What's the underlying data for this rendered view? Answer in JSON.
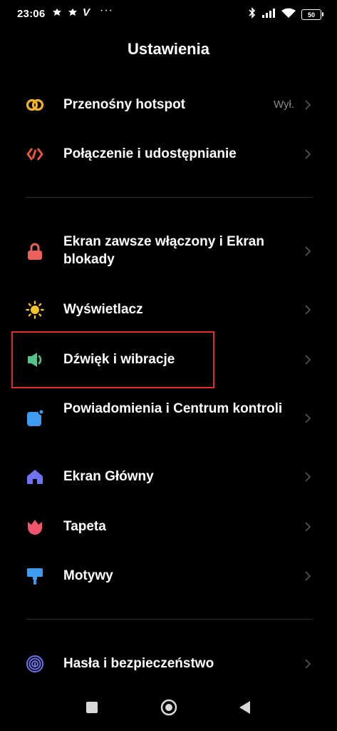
{
  "status_bar": {
    "time": "23:06",
    "indicators": [
      "notification-icon",
      "notification-icon",
      "v-app-icon",
      "more-dots"
    ],
    "battery": "50"
  },
  "header": {
    "title": "Ustawienia"
  },
  "settings": [
    {
      "label": "Przenośny hotspot",
      "value": "Wył.",
      "icon": "hotspot-icon",
      "color": "#F0B22A"
    },
    {
      "label": "Połączenie i udostępnianie",
      "icon": "connection-sharing-icon",
      "color": "#E8553C"
    },
    {
      "label": "Ekran zawsze włączony i Ekran blokady",
      "icon": "lock-icon",
      "color": "#E8615A"
    },
    {
      "label": "Wyświetlacz",
      "icon": "brightness-icon",
      "color": "#F4C22B"
    },
    {
      "label": "Dźwięk i wibracje",
      "icon": "speaker-icon",
      "color": "#4FC58A",
      "highlighted": true
    },
    {
      "label": "Powiadomienia i Centrum kontroli",
      "icon": "notifications-icon",
      "color": "#3E9BF0"
    },
    {
      "label": "Ekran Główny",
      "icon": "home-icon",
      "color": "#6E73F2"
    },
    {
      "label": "Tapeta",
      "icon": "wallpaper-tulip-icon",
      "color": "#F0556C"
    },
    {
      "label": "Motywy",
      "icon": "themes-brush-icon",
      "color": "#3E9BF0"
    },
    {
      "label": "Hasła i bezpieczeństwo",
      "icon": "fingerprint-icon",
      "color": "#6E73F2"
    }
  ],
  "nav_bar": [
    "recents-square-icon",
    "home-circle-icon",
    "back-triangle-icon"
  ]
}
